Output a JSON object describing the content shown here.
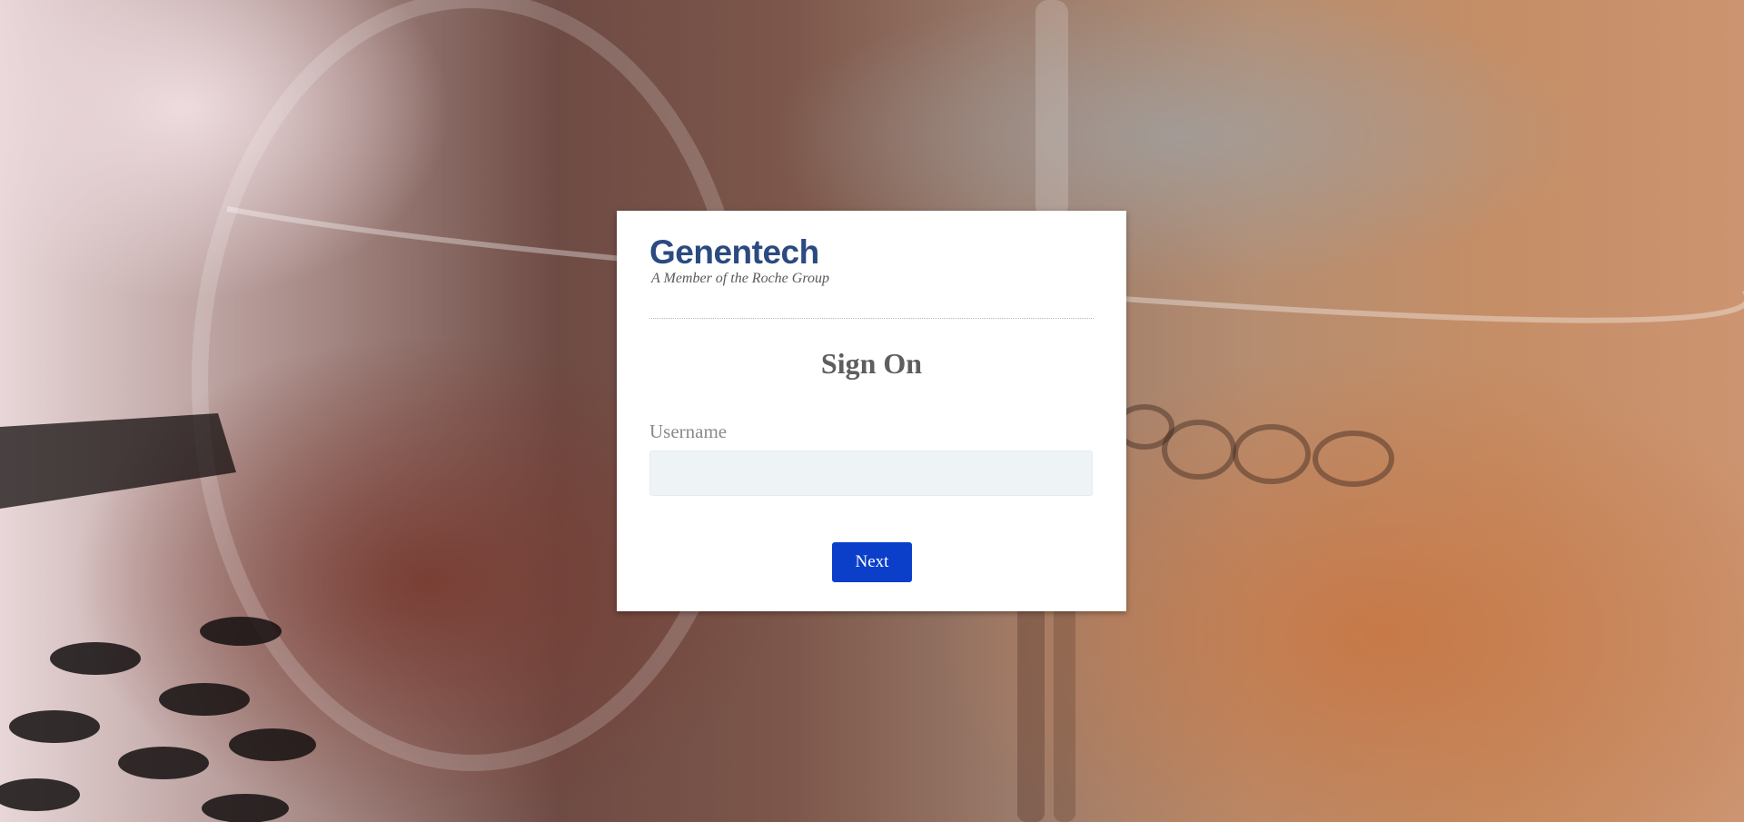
{
  "background": {
    "description_icon": "lab-glassware-photo"
  },
  "logo": {
    "brand": "Genentech",
    "tagline": "A Member of the Roche Group",
    "brand_color": "#2b4a82"
  },
  "form": {
    "title": "Sign On",
    "username_label": "Username",
    "username_value": "",
    "username_placeholder": "",
    "next_label": "Next",
    "button_color": "#0b3fca"
  }
}
